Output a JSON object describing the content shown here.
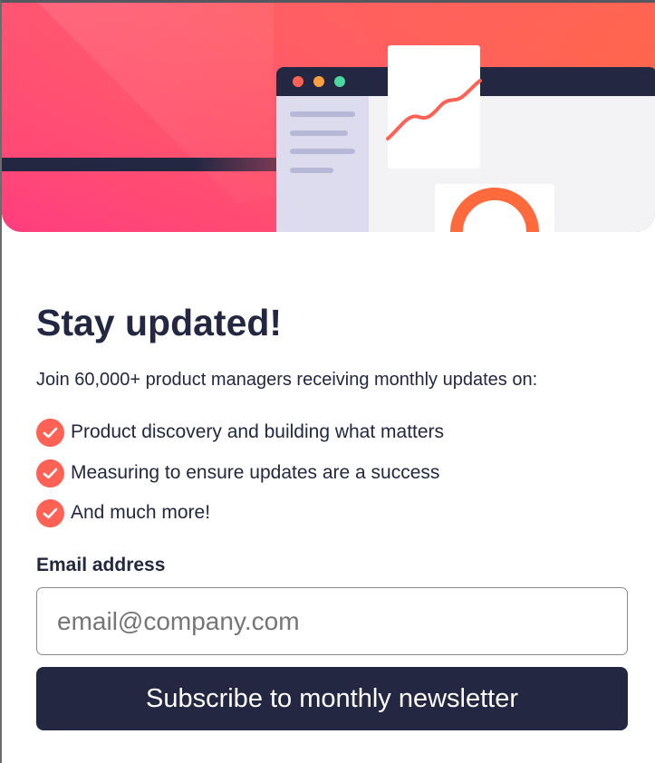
{
  "colors": {
    "accent": "#ff6155",
    "dark": "#242742",
    "gradient_start": "#ff527b",
    "gradient_end": "#ff6a3d"
  },
  "hero": {
    "illustration": "dashboard-illustration",
    "window_dots": [
      "#ff6155",
      "#ff9f43",
      "#4ad7a0"
    ]
  },
  "title": "Stay updated!",
  "intro": "Join 60,000+ product managers receiving monthly updates on:",
  "benefits": [
    {
      "icon": "check-icon",
      "text": "Product discovery and building what matters"
    },
    {
      "icon": "check-icon",
      "text": "Measuring to ensure updates are a success"
    },
    {
      "icon": "check-icon",
      "text": "And much more!"
    }
  ],
  "form": {
    "email_label": "Email address",
    "email_placeholder": "email@company.com",
    "email_value": "",
    "submit_label": "Subscribe to monthly newsletter"
  }
}
